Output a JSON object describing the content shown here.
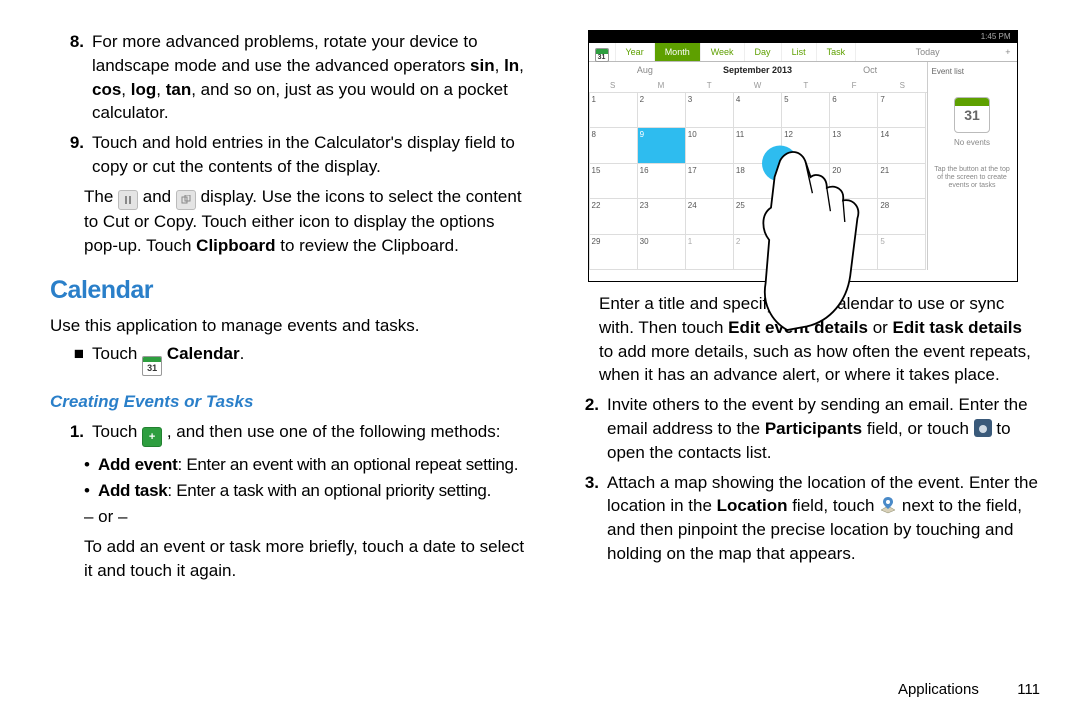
{
  "left": {
    "items": [
      {
        "num": "8.",
        "text_parts": [
          "For more advanced problems, rotate your device to landscape mode and use the advanced operators ",
          "sin",
          ", ",
          "ln",
          ", ",
          "cos",
          ", ",
          "log",
          ", ",
          "tan",
          ", and so on, just as you would on a pocket calculator."
        ]
      },
      {
        "num": "9.",
        "text": "Touch and hold entries in the Calculator's display field to copy or cut the contents of the display."
      }
    ],
    "icon_paragraph": {
      "p1": "The ",
      "p2": " and ",
      "p3": " display. Use the icons to select the content to Cut or Copy. Touch either icon to display the options pop-up. Touch ",
      "p4": "Clipboard",
      "p5": " to review the Clipboard."
    },
    "h1": "Calendar",
    "intro": "Use this application to manage events and tasks.",
    "touch_row": {
      "bullet": "■",
      "pre": "Touch ",
      "label": "Calendar",
      "post": "."
    },
    "h2": "Creating Events or Tasks",
    "step1": {
      "num": "1.",
      "pre": "Touch ",
      "post": ", and then use one of the following methods:"
    },
    "sub": [
      {
        "b": "Add event",
        "t": ": Enter an event with an optional repeat setting."
      },
      {
        "b": "Add task",
        "t": ": Enter a task with an optional priority setting."
      }
    ],
    "or": "– or –",
    "after": "To add an event or task more briefly, touch a date to select it and touch it again."
  },
  "right": {
    "figure": {
      "status_text": "1:45 PM",
      "tabs": [
        "Year",
        "Month",
        "Week",
        "Day",
        "List",
        "Task"
      ],
      "today": "Today",
      "months": {
        "prev": "Aug",
        "cur_label": "September",
        "cur_year": "2013",
        "next": "Oct"
      },
      "dow": [
        "S",
        "M",
        "T",
        "W",
        "T",
        "F",
        "S"
      ],
      "side": {
        "label": "Event list",
        "big_day": "31",
        "no_events": "No events",
        "hint": "Tap the button at the top of the screen to create events or tasks"
      }
    },
    "para1": {
      "a": "Enter a title and specify which calendar to use or sync with. Then touch ",
      "b1": "Edit event details",
      "mid": " or ",
      "b2": "Edit task details",
      "c": " to add more details, such as how often the event repeats, when it has an advance alert, or where it takes place."
    },
    "step2": {
      "num": "2.",
      "a": "Invite others to the event by sending an email. Enter the email address to the ",
      "b": "Participants",
      "c": " field, or touch ",
      "d": " to open the contacts list."
    },
    "step3": {
      "num": "3.",
      "a": "Attach a map showing the location of the event. Enter the location in the ",
      "b": "Location",
      "c": " field, touch ",
      "d": " next to the field, and then pinpoint the precise location by touching and holding on the map that appears."
    },
    "footer": {
      "section": "Applications",
      "page": "111"
    }
  }
}
